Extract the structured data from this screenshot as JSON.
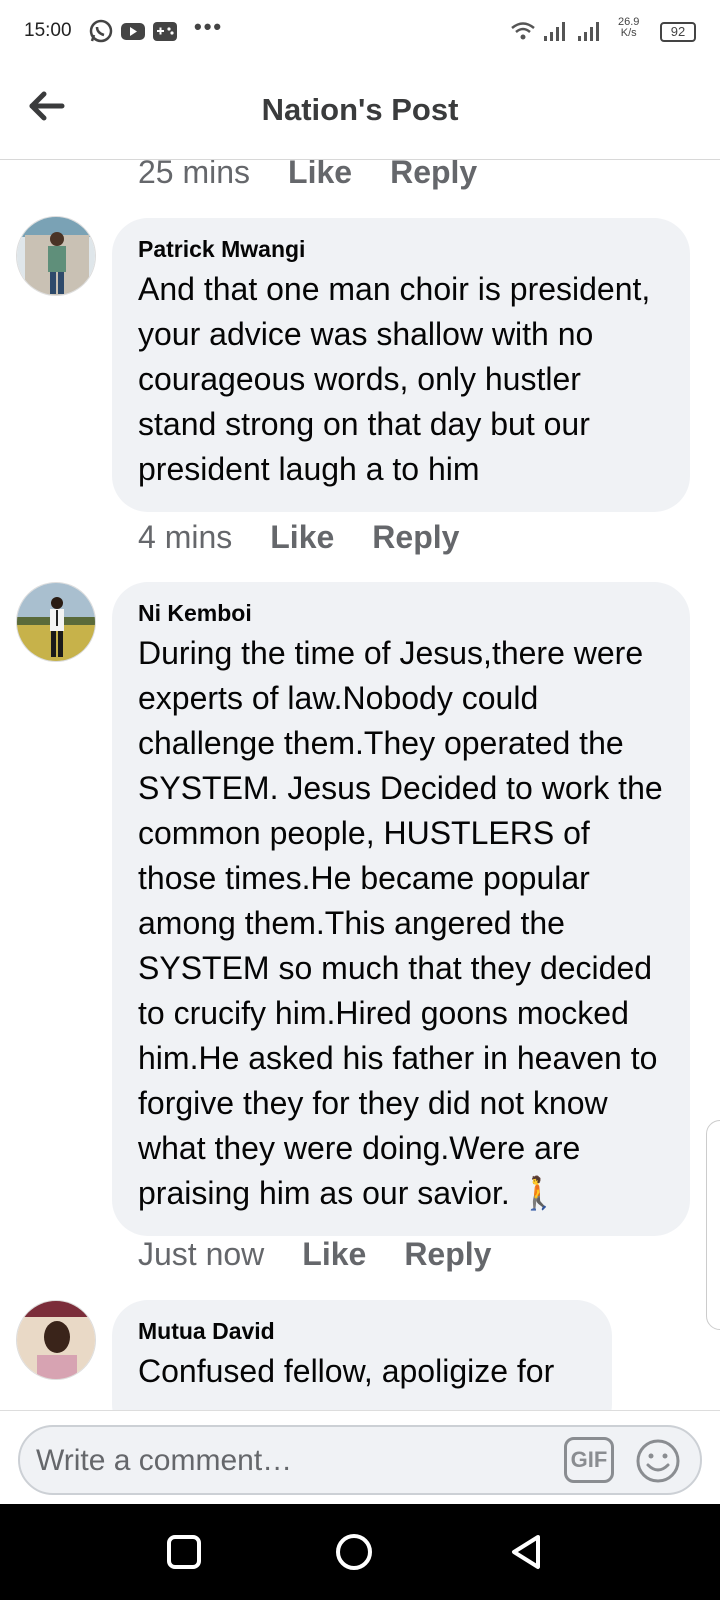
{
  "status_bar": {
    "time": "15:00",
    "notification_icons": [
      "whatsapp-icon",
      "youtube-icon",
      "game-controller-icon"
    ],
    "more": "•••",
    "speed_value": "26.9",
    "speed_unit": "K/s",
    "battery": "92"
  },
  "header": {
    "title": "Nation's Post",
    "back_icon": "arrow-left-icon"
  },
  "comments": [
    {
      "time": "25 mins",
      "like": "Like",
      "reply": "Reply"
    },
    {
      "author": "Patrick Mwangi",
      "text": "And that one man choir is president, your advice was shallow with no courageous words, only hustler stand strong on that day but our president laugh a to him",
      "time": "4 mins",
      "like": "Like",
      "reply": "Reply"
    },
    {
      "author": "Ni Kemboi",
      "text": "During the time of Jesus,there were experts of law.Nobody could challenge them.They operated the SYSTEM. Jesus Decided to work the common people, HUSTLERS of those times.He became popular among them.This angered the SYSTEM so much that they decided to crucify him.Hired goons mocked him.He asked his father in heaven to forgive they for they did not know what they were doing.Were are praising him as our savior. 🚶",
      "time": "Just now",
      "like": "Like",
      "reply": "Reply"
    },
    {
      "author": "Mutua David",
      "text": "Confused fellow, apoligize for"
    }
  ],
  "composer": {
    "placeholder": "Write a comment…",
    "gif_label": "GIF",
    "emoji_icon": "smiley-icon"
  },
  "nav": [
    "square-icon",
    "circle-icon",
    "triangle-back-icon"
  ]
}
